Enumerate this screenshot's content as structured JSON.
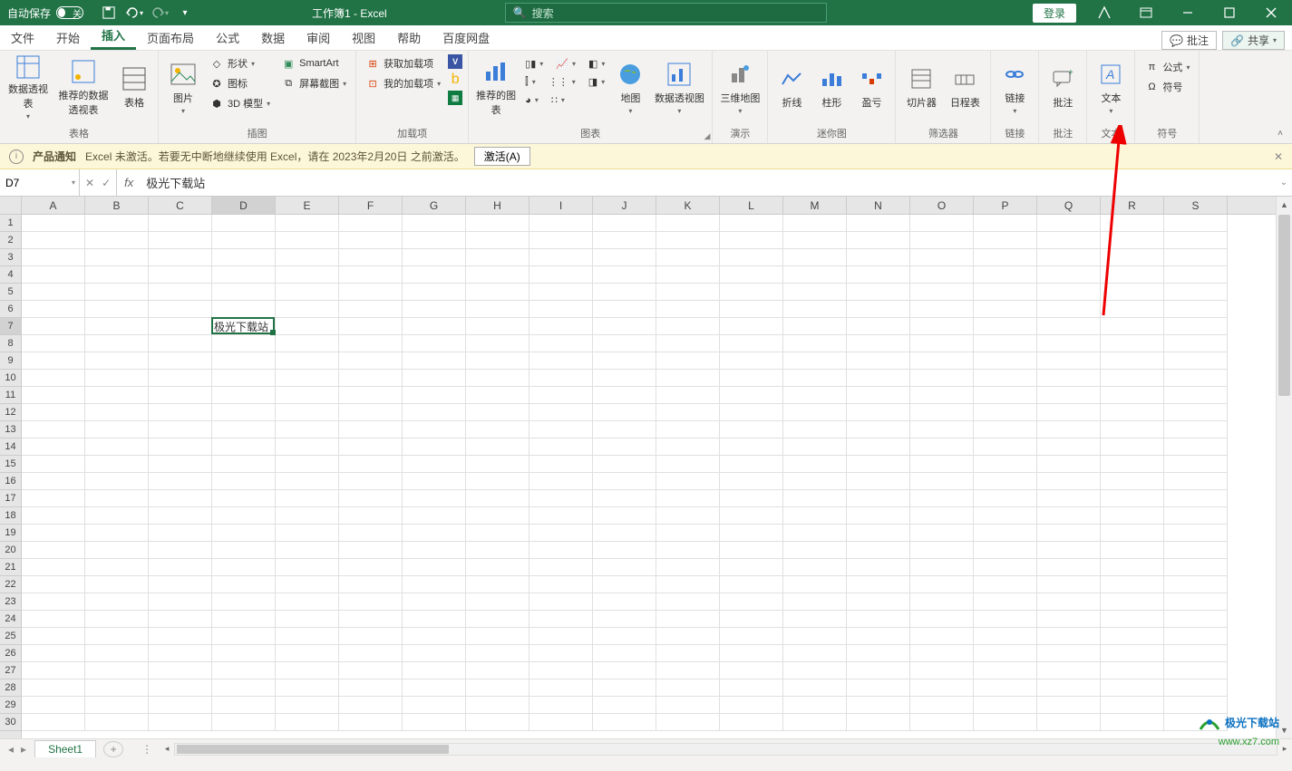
{
  "titlebar": {
    "autosave_label": "自动保存",
    "autosave_state": "关",
    "doc_title": "工作簿1  -  Excel",
    "search_placeholder": "搜索",
    "login_label": "登录"
  },
  "tabs": {
    "file": "文件",
    "home": "开始",
    "insert": "插入",
    "page_layout": "页面布局",
    "formulas": "公式",
    "data": "数据",
    "review": "审阅",
    "view": "视图",
    "help": "帮助",
    "baidu": "百度网盘",
    "comments_btn": "批注",
    "share_btn": "共享"
  },
  "ribbon": {
    "tables": {
      "pivot": "数据透视表",
      "recommended_pivot": "推荐的数据透视表",
      "table": "表格",
      "group_label": "表格"
    },
    "illustrations": {
      "pictures": "图片",
      "shapes": "形状",
      "icons": "图标",
      "models": "3D 模型",
      "smartart": "SmartArt",
      "screenshot": "屏幕截图",
      "group_label": "插图"
    },
    "addins": {
      "get": "获取加载项",
      "my": "我的加载项",
      "group_label": "加载项"
    },
    "charts": {
      "recommended": "推荐的图表",
      "maps": "地图",
      "pivotchart": "数据透视图",
      "group_label": "图表"
    },
    "tours": {
      "map3d": "三维地图",
      "group_label": "演示"
    },
    "sparklines": {
      "line": "折线",
      "column": "柱形",
      "winloss": "盈亏",
      "group_label": "迷你图"
    },
    "filters": {
      "slicer": "切片器",
      "timeline": "日程表",
      "group_label": "筛选器"
    },
    "links": {
      "link": "链接",
      "group_label": "链接"
    },
    "comments": {
      "comment": "批注",
      "group_label": "批注"
    },
    "text": {
      "text": "文本",
      "group_label": "文本"
    },
    "symbols": {
      "equation": "公式",
      "symbol": "符号",
      "group_label": "符号"
    }
  },
  "notification": {
    "title": "产品通知",
    "message": "Excel 未激活。若要无中断地继续使用 Excel，请在 2023年2月20日 之前激活。",
    "activate_btn": "激活(A)"
  },
  "formula_bar": {
    "name_box": "D7",
    "formula_value": "极光下载站"
  },
  "grid": {
    "columns": [
      "A",
      "B",
      "C",
      "D",
      "E",
      "F",
      "G",
      "H",
      "I",
      "J",
      "K",
      "L",
      "M",
      "N",
      "O",
      "P",
      "Q",
      "R",
      "S"
    ],
    "row_count": 30,
    "active_cell": {
      "row": 7,
      "col_index": 3
    },
    "cell_value": "极光下载站"
  },
  "sheets": {
    "sheet1": "Sheet1"
  },
  "watermark": {
    "line1": "极光下载站",
    "line2": "www.xz7.com"
  }
}
